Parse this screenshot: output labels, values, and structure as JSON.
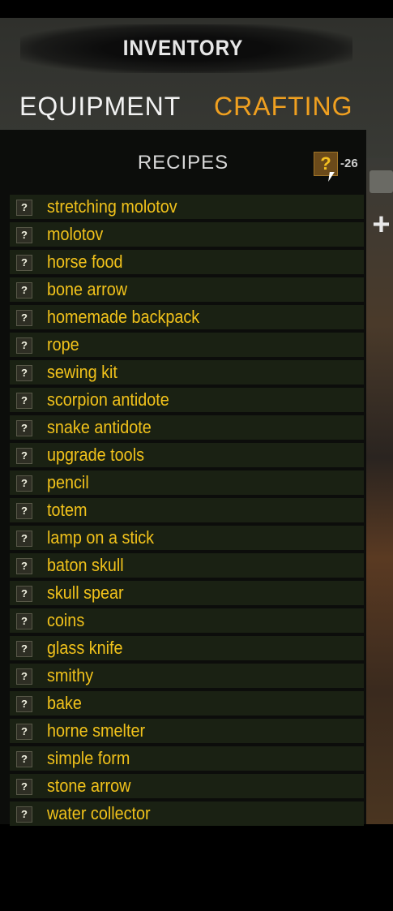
{
  "header": {
    "title": "INVENTORY"
  },
  "tabs": [
    {
      "label": "EQUIPMENT",
      "active": false
    },
    {
      "label": "CRAFTING",
      "active": true
    }
  ],
  "recipes": {
    "title": "RECIPES",
    "unknown_icon": "?",
    "count": "-26",
    "items": [
      "stretching molotov",
      "molotov",
      "horse food",
      "bone arrow",
      "homemade backpack",
      "rope",
      "sewing kit",
      "scorpion antidote",
      "snake antidote",
      "upgrade tools",
      "pencil",
      "totem",
      "lamp on a stick",
      "baton skull",
      "skull spear",
      "coins",
      "glass knife",
      "smithy",
      "bake",
      "horne smelter",
      "simple form",
      "stone arrow",
      "water collector"
    ]
  },
  "side": {
    "plus_icon": "+"
  },
  "colors": {
    "accent": "#f0a020",
    "item_text": "#f1c21b",
    "row_bg": "#1a2113"
  }
}
